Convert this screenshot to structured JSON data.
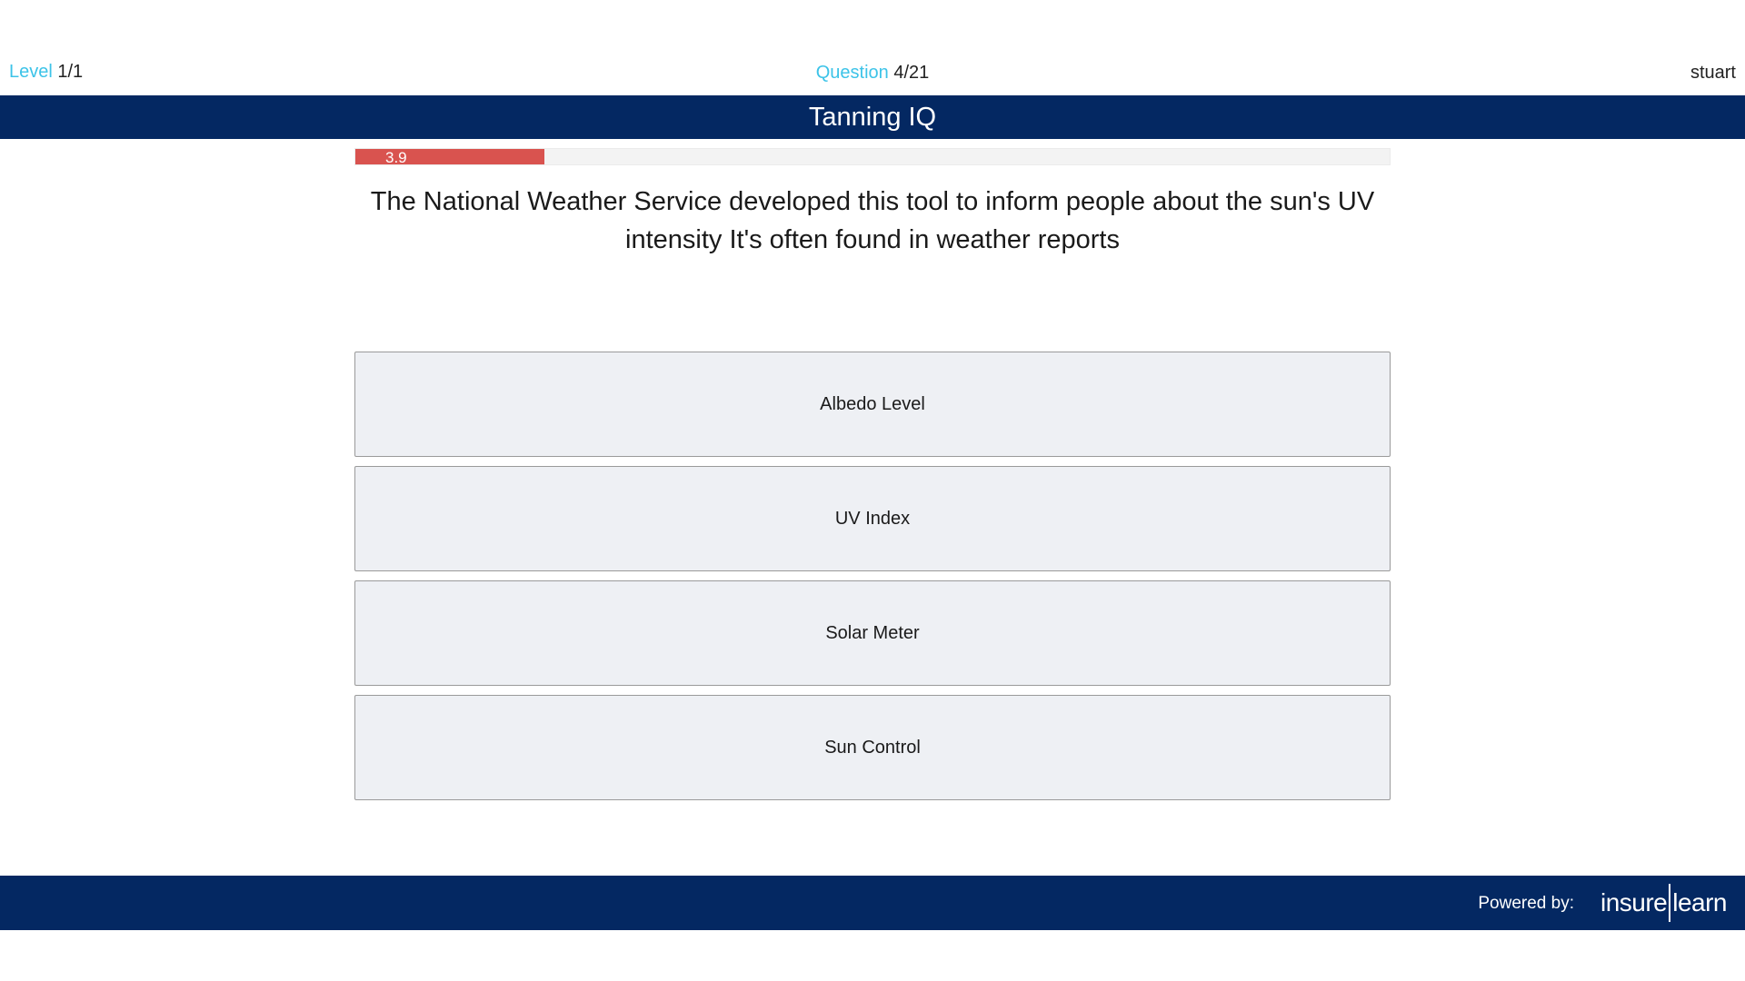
{
  "header": {
    "level_label": "Level",
    "level_value": "1/1",
    "question_label": "Question",
    "question_value": "4/21",
    "username": "stuart"
  },
  "title": "Tanning IQ",
  "progress": {
    "label": "3.9",
    "fraction": 0.183
  },
  "question": {
    "text": "The National Weather Service developed this tool to inform people about the sun's UV intensity It's often found in weather reports"
  },
  "answers": [
    {
      "label": "Albedo Level"
    },
    {
      "label": "UV Index"
    },
    {
      "label": "Solar Meter"
    },
    {
      "label": "Sun Control"
    }
  ],
  "footer": {
    "powered_by": "Powered by:",
    "logo_left": "insure",
    "logo_right": "learn"
  },
  "colors": {
    "brand_navy": "#042862",
    "accent_cyan": "#3cc3e8",
    "timer_red": "#d9534f",
    "answer_bg": "#eef0f4"
  }
}
